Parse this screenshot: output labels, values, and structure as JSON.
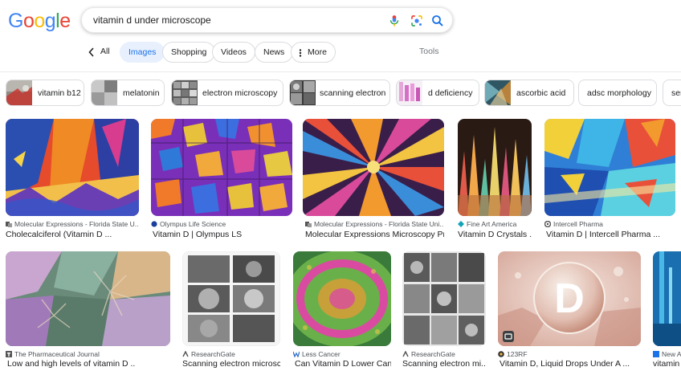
{
  "logo": [
    "G",
    "o",
    "o",
    "g",
    "l",
    "e"
  ],
  "colors": {
    "logo": [
      "#4285f4",
      "#ea4335",
      "#fbbc05",
      "#4285f4",
      "#34a853",
      "#ea4335"
    ],
    "accent": "#1a73e8",
    "active_tab_bg": "#e8f0fe"
  },
  "search": {
    "query": "vitamin d under microscope"
  },
  "icons": {
    "mic": "microphone-icon",
    "lens": "google-lens-icon",
    "search": "search-icon",
    "back": "chevron-left-icon",
    "more": "more-vert-icon"
  },
  "tabs": {
    "all": "All",
    "images": "Images",
    "shopping": "Shopping",
    "videos": "Videos",
    "news": "News",
    "more": "More",
    "tools": "Tools"
  },
  "chips": [
    "vitamin b12",
    "melatonin",
    "electron microscopy",
    "scanning electron",
    "d deficiency",
    "ascorbic acid",
    "adsc morphology",
    "ser"
  ],
  "results": [
    {
      "source": "Molecular Expressions - Florida State U...",
      "title": "Cholecalciferol (Vitamin D ..."
    },
    {
      "source": "Olympus Life Science",
      "title": "Vitamin D | Olympus LS"
    },
    {
      "source": "Molecular Expressions - Florida State Uni...",
      "title": "Molecular Expressions Microscopy Pri..."
    },
    {
      "source": "Fine Art America",
      "title": "Vitamin D Crystals ..."
    },
    {
      "source": "Intercell Pharma",
      "title": "Vitamin D | Intercell Pharma ..."
    },
    {
      "source": "The Pharmaceutical Journal",
      "title": "Low and high levels of vitamin D ..."
    },
    {
      "source": "ResearchGate",
      "title": "Scanning electron microsc..."
    },
    {
      "source": "Less Cancer",
      "title": "Can Vitamin D Lower Can..."
    },
    {
      "source": "ResearchGate",
      "title": "Scanning electron mi..."
    },
    {
      "source": "123RF",
      "title": "Vitamin D, Liquid Drops Under A ..."
    },
    {
      "source": "New A",
      "title": "vitamin"
    }
  ],
  "overlay_letter": "D"
}
